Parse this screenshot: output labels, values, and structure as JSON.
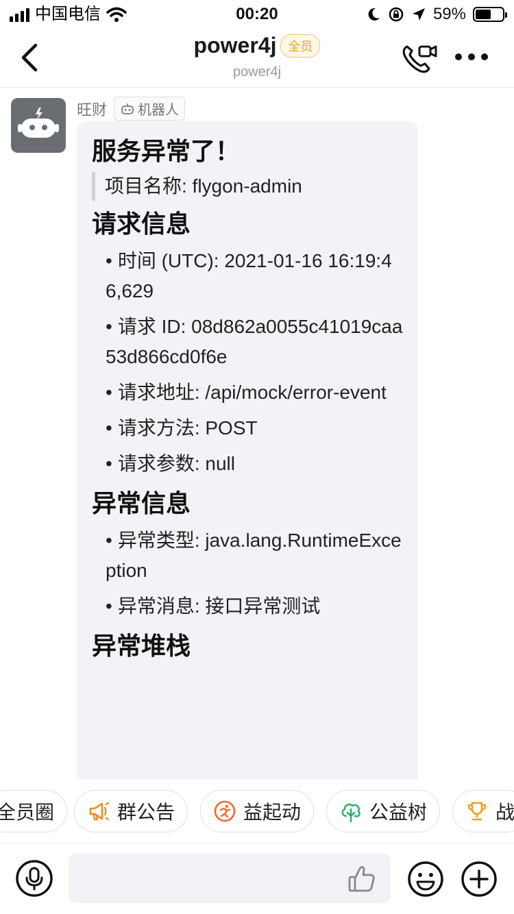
{
  "status_bar": {
    "carrier": "中国电信",
    "time": "00:20",
    "battery_percent": "59%",
    "battery_level": 0.59
  },
  "nav": {
    "title": "power4j",
    "badge": "全员",
    "subtitle": "power4j",
    "icons": [
      "back-arrow-icon",
      "video-call-icon",
      "more-icon"
    ]
  },
  "message": {
    "sender": "旺财",
    "sender_tag": "机器人",
    "title": "服务异常了！",
    "project": "项目名称: flygon-admin",
    "sections": [
      {
        "heading": "请求信息",
        "items": [
          "时间 (UTC): 2021-01-16 16:19:46,629",
          "请求 ID: 08d862a0055c41019caa53d866cd0f6e",
          "请求地址: /api/mock/error-event",
          "请求方法: POST",
          "请求参数: null"
        ]
      },
      {
        "heading": "异常信息",
        "items": [
          "异常类型: java.lang.RuntimeException",
          "异常消息: 接口异常测试"
        ]
      },
      {
        "heading": "异常堆栈",
        "items": []
      }
    ]
  },
  "quick_actions": [
    {
      "label": "全员圈",
      "icon": "circle-icon"
    },
    {
      "label": "群公告",
      "icon": "megaphone-icon",
      "color": "#f08a24"
    },
    {
      "label": "益起动",
      "icon": "run-icon",
      "color": "#f06a2a"
    },
    {
      "label": "公益树",
      "icon": "tree-icon",
      "color": "#2bb36a"
    },
    {
      "label": "战",
      "icon": "trophy-icon",
      "color": "#f0a020"
    }
  ],
  "input_bar": {
    "icons": [
      "microphone-icon",
      "thumbs-up-icon",
      "emoji-icon",
      "plus-icon"
    ]
  }
}
